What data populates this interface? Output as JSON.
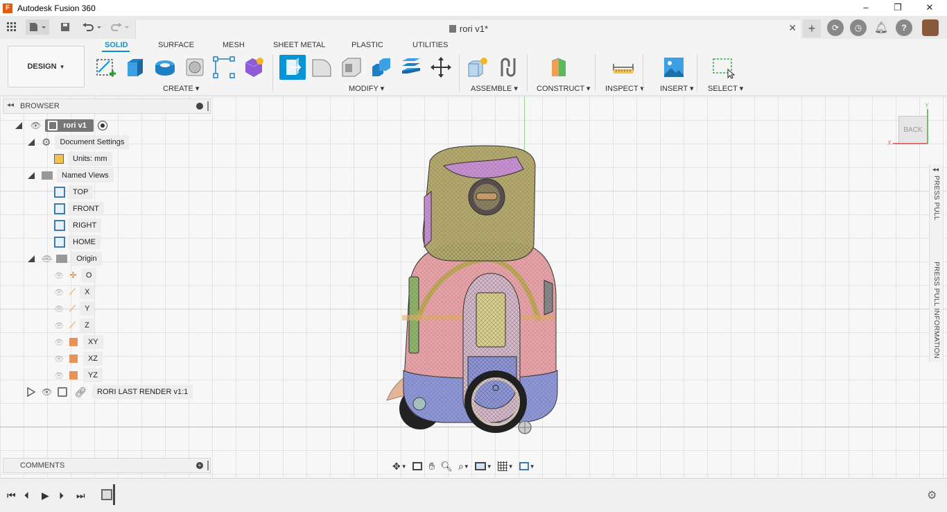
{
  "window": {
    "app_logo": "F",
    "title": "Autodesk Fusion 360",
    "min": "–",
    "max": "❐",
    "close": "✕"
  },
  "document_tab": {
    "title": "rori v1*",
    "close": "✕"
  },
  "workspace": {
    "label": "DESIGN",
    "tabs": [
      "SOLID",
      "SURFACE",
      "MESH",
      "SHEET METAL",
      "PLASTIC",
      "UTILITIES"
    ],
    "active_tab": "SOLID"
  },
  "toolbar_groups": {
    "create": "CREATE",
    "modify": "MODIFY",
    "assemble": "ASSEMBLE",
    "construct": "CONSTRUCT",
    "inspect": "INSPECT",
    "insert": "INSERT",
    "select": "SELECT"
  },
  "browser": {
    "title": "BROWSER",
    "root": "rori v1",
    "document_settings": "Document Settings",
    "units": "Units: mm",
    "named_views": "Named Views",
    "views": [
      "TOP",
      "FRONT",
      "RIGHT",
      "HOME"
    ],
    "origin": "Origin",
    "origin_items": [
      "O",
      "X",
      "Y",
      "Z",
      "XY",
      "XZ",
      "YZ"
    ],
    "component": "RORI LAST RENDER v1:1"
  },
  "comments": {
    "title": "COMMENTS"
  },
  "viewcube": {
    "face": "BACK",
    "x_axis": "X",
    "y_axis": "Y"
  },
  "side_panel": {
    "top": "PRESS PULL",
    "bottom": "PRESS PULL INFORMATION"
  },
  "colors": {
    "accent": "#0696d7",
    "body_pink": "#e8a3a8",
    "body_blue": "#8f96d6",
    "head_olive": "#b3a86d",
    "logo_orange": "#e35a0f"
  }
}
